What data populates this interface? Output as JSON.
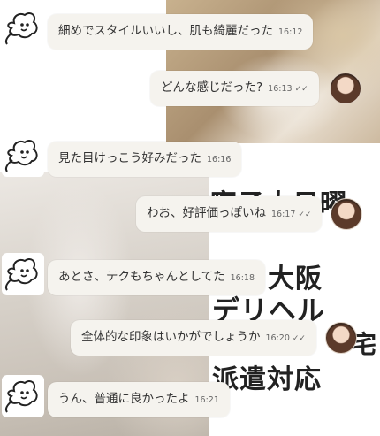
{
  "background": {
    "overlay_lines": [
      "寝子大日曜",
      "・大阪",
      "デリヘル",
      "宅",
      "派遣対応"
    ]
  },
  "messages": [
    {
      "side": "left",
      "text": "細めでスタイルいいし、肌も綺麗だった",
      "time": "16:12"
    },
    {
      "side": "right",
      "text": "どんな感じだった?",
      "time": "16:13",
      "status": "✓✓"
    },
    {
      "side": "left",
      "text": "見た目けっこう好みだった",
      "time": "16:16"
    },
    {
      "side": "right",
      "text": "わお、好評価っぽいね",
      "time": "16:17",
      "status": "✓✓"
    },
    {
      "side": "left",
      "text": "あとさ、テクもちゃんとしてた",
      "time": "16:18"
    },
    {
      "side": "right",
      "text": "全体的な印象はいかがでしょうか",
      "time": "16:20",
      "status": "✓✓"
    },
    {
      "side": "left",
      "text": "うん、普通に良かったよ",
      "time": "16:21"
    }
  ],
  "icons": {
    "bot_avatar": "cartoon-ghost-avatar-icon",
    "user_avatar": "user-photo-avatar",
    "read_status": "double-check-icon"
  }
}
